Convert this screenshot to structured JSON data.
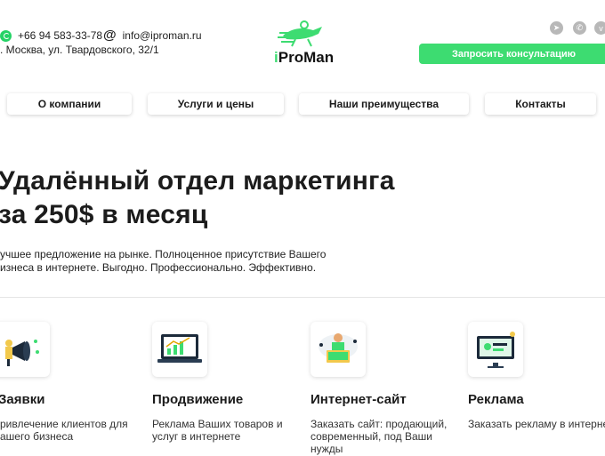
{
  "header": {
    "phone": "+66 94 583-33-78",
    "email": "info@iproman.ru",
    "address": ". Москва, ул. Твардовского, 32/1",
    "logo_prefix": "i",
    "logo_main": "ProMan",
    "cta_label": "Запросить консультацию",
    "social_icons": [
      "telegram-icon",
      "viber-icon",
      "vk-icon"
    ]
  },
  "nav": {
    "items": [
      "О компании",
      "Услуги и цены",
      "Наши преимущества",
      "Контакты"
    ]
  },
  "hero": {
    "title_line1": "Удалённый отдел маркетинга",
    "title_line2": "за 250$ в месяц",
    "subtitle_line1": "учшее предложение на рынке. Полноценное присутствие Вашего",
    "subtitle_line2": "изнеса в интернете. Выгодно. Профессионально. Эффективно."
  },
  "services": [
    {
      "title": "Заявки",
      "desc_line1": "ривлечение клиентов для",
      "desc_line2": "ашего бизнеса",
      "desc_line3": "",
      "icon": "megaphone-icon"
    },
    {
      "title": "Продвижение",
      "desc_line1": "Реклама Ваших товаров и",
      "desc_line2": "услуг в интернете",
      "desc_line3": "",
      "icon": "laptop-chart-icon"
    },
    {
      "title": "Интернет-сайт",
      "desc_line1": "Заказать сайт: продающий,",
      "desc_line2": "современный, под Ваши",
      "desc_line3": "нужды",
      "icon": "website-builder-icon"
    },
    {
      "title": "Реклама",
      "desc_line1": "Заказать рекламу в интернете",
      "desc_line2": "",
      "desc_line3": "",
      "icon": "monitor-ads-icon"
    }
  ],
  "colors": {
    "accent": "#3ddc71",
    "text": "#1c1c1c",
    "social": "#b8b8b8"
  }
}
